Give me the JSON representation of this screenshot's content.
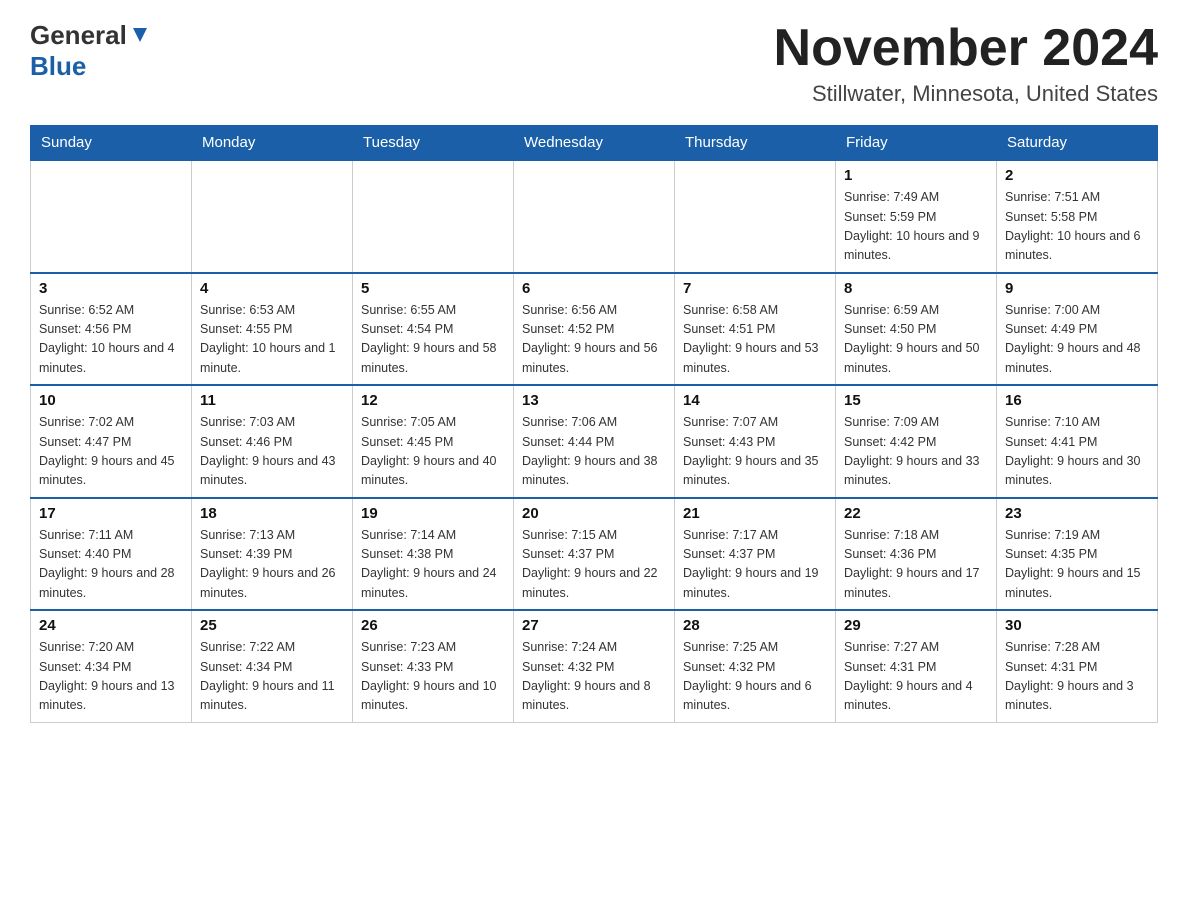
{
  "header": {
    "logo_general": "General",
    "logo_blue": "Blue",
    "month_title": "November 2024",
    "location": "Stillwater, Minnesota, United States"
  },
  "days_of_week": [
    "Sunday",
    "Monday",
    "Tuesday",
    "Wednesday",
    "Thursday",
    "Friday",
    "Saturday"
  ],
  "weeks": [
    {
      "days": [
        {
          "number": "",
          "info": ""
        },
        {
          "number": "",
          "info": ""
        },
        {
          "number": "",
          "info": ""
        },
        {
          "number": "",
          "info": ""
        },
        {
          "number": "",
          "info": ""
        },
        {
          "number": "1",
          "info": "Sunrise: 7:49 AM\nSunset: 5:59 PM\nDaylight: 10 hours and 9 minutes."
        },
        {
          "number": "2",
          "info": "Sunrise: 7:51 AM\nSunset: 5:58 PM\nDaylight: 10 hours and 6 minutes."
        }
      ]
    },
    {
      "days": [
        {
          "number": "3",
          "info": "Sunrise: 6:52 AM\nSunset: 4:56 PM\nDaylight: 10 hours and 4 minutes."
        },
        {
          "number": "4",
          "info": "Sunrise: 6:53 AM\nSunset: 4:55 PM\nDaylight: 10 hours and 1 minute."
        },
        {
          "number": "5",
          "info": "Sunrise: 6:55 AM\nSunset: 4:54 PM\nDaylight: 9 hours and 58 minutes."
        },
        {
          "number": "6",
          "info": "Sunrise: 6:56 AM\nSunset: 4:52 PM\nDaylight: 9 hours and 56 minutes."
        },
        {
          "number": "7",
          "info": "Sunrise: 6:58 AM\nSunset: 4:51 PM\nDaylight: 9 hours and 53 minutes."
        },
        {
          "number": "8",
          "info": "Sunrise: 6:59 AM\nSunset: 4:50 PM\nDaylight: 9 hours and 50 minutes."
        },
        {
          "number": "9",
          "info": "Sunrise: 7:00 AM\nSunset: 4:49 PM\nDaylight: 9 hours and 48 minutes."
        }
      ]
    },
    {
      "days": [
        {
          "number": "10",
          "info": "Sunrise: 7:02 AM\nSunset: 4:47 PM\nDaylight: 9 hours and 45 minutes."
        },
        {
          "number": "11",
          "info": "Sunrise: 7:03 AM\nSunset: 4:46 PM\nDaylight: 9 hours and 43 minutes."
        },
        {
          "number": "12",
          "info": "Sunrise: 7:05 AM\nSunset: 4:45 PM\nDaylight: 9 hours and 40 minutes."
        },
        {
          "number": "13",
          "info": "Sunrise: 7:06 AM\nSunset: 4:44 PM\nDaylight: 9 hours and 38 minutes."
        },
        {
          "number": "14",
          "info": "Sunrise: 7:07 AM\nSunset: 4:43 PM\nDaylight: 9 hours and 35 minutes."
        },
        {
          "number": "15",
          "info": "Sunrise: 7:09 AM\nSunset: 4:42 PM\nDaylight: 9 hours and 33 minutes."
        },
        {
          "number": "16",
          "info": "Sunrise: 7:10 AM\nSunset: 4:41 PM\nDaylight: 9 hours and 30 minutes."
        }
      ]
    },
    {
      "days": [
        {
          "number": "17",
          "info": "Sunrise: 7:11 AM\nSunset: 4:40 PM\nDaylight: 9 hours and 28 minutes."
        },
        {
          "number": "18",
          "info": "Sunrise: 7:13 AM\nSunset: 4:39 PM\nDaylight: 9 hours and 26 minutes."
        },
        {
          "number": "19",
          "info": "Sunrise: 7:14 AM\nSunset: 4:38 PM\nDaylight: 9 hours and 24 minutes."
        },
        {
          "number": "20",
          "info": "Sunrise: 7:15 AM\nSunset: 4:37 PM\nDaylight: 9 hours and 22 minutes."
        },
        {
          "number": "21",
          "info": "Sunrise: 7:17 AM\nSunset: 4:37 PM\nDaylight: 9 hours and 19 minutes."
        },
        {
          "number": "22",
          "info": "Sunrise: 7:18 AM\nSunset: 4:36 PM\nDaylight: 9 hours and 17 minutes."
        },
        {
          "number": "23",
          "info": "Sunrise: 7:19 AM\nSunset: 4:35 PM\nDaylight: 9 hours and 15 minutes."
        }
      ]
    },
    {
      "days": [
        {
          "number": "24",
          "info": "Sunrise: 7:20 AM\nSunset: 4:34 PM\nDaylight: 9 hours and 13 minutes."
        },
        {
          "number": "25",
          "info": "Sunrise: 7:22 AM\nSunset: 4:34 PM\nDaylight: 9 hours and 11 minutes."
        },
        {
          "number": "26",
          "info": "Sunrise: 7:23 AM\nSunset: 4:33 PM\nDaylight: 9 hours and 10 minutes."
        },
        {
          "number": "27",
          "info": "Sunrise: 7:24 AM\nSunset: 4:32 PM\nDaylight: 9 hours and 8 minutes."
        },
        {
          "number": "28",
          "info": "Sunrise: 7:25 AM\nSunset: 4:32 PM\nDaylight: 9 hours and 6 minutes."
        },
        {
          "number": "29",
          "info": "Sunrise: 7:27 AM\nSunset: 4:31 PM\nDaylight: 9 hours and 4 minutes."
        },
        {
          "number": "30",
          "info": "Sunrise: 7:28 AM\nSunset: 4:31 PM\nDaylight: 9 hours and 3 minutes."
        }
      ]
    }
  ]
}
